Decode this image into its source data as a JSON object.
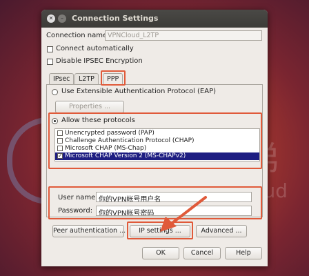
{
  "window": {
    "title": "Connection Settings"
  },
  "connection": {
    "name_label": "Connection name:",
    "name_value": "VPNCloud_L2TP"
  },
  "options": {
    "connect_auto": "Connect automatically",
    "disable_ipsec": "Disable IPSEC Encryption"
  },
  "tabs": [
    {
      "label": "IPsec"
    },
    {
      "label": "L2TP"
    },
    {
      "label": "PPP"
    }
  ],
  "ppp": {
    "eap_label": "Use Extensible Authentication Protocol (EAP)",
    "properties_label": "Properties ...",
    "allow_label": "Allow these protocols",
    "protocols": [
      {
        "label": "Unencrypted password (PAP)",
        "checked": false
      },
      {
        "label": "Challenge Authentication Protocol (CHAP)",
        "checked": false
      },
      {
        "label": "Microsoft CHAP (MS-Chap)",
        "checked": false
      },
      {
        "label": "Microsoft CHAP Version 2 (MS-CHAPv2)",
        "checked": true
      }
    ],
    "username_label": "User name:",
    "username_value": "你的VPN帐号用户名",
    "password_label": "Password:",
    "password_value": "你的VPN帐号密码"
  },
  "buttons": {
    "peer_auth": "Peer authentication ...",
    "ip_settings": "IP settings ...",
    "advanced": "Advanced ...",
    "ok": "OK",
    "cancel": "Cancel",
    "help": "Help"
  },
  "watermark": {
    "brand_cn": "云梯",
    "brand_en": "VPNCloud"
  },
  "colors": {
    "highlight": "#e05a3a",
    "selection": "#1e1e82"
  }
}
